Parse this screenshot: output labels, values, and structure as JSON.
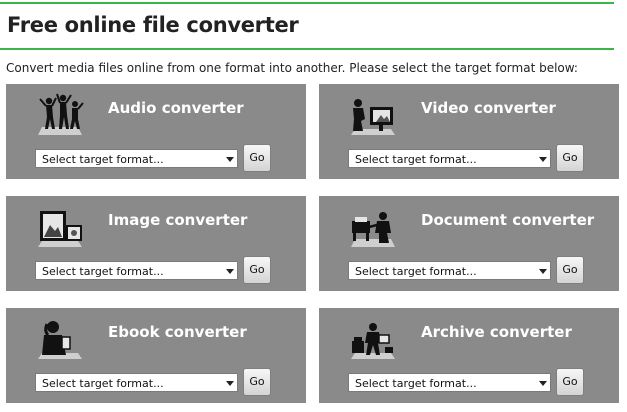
{
  "header": {
    "title": "Free online file converter"
  },
  "intro": "Convert media files online from one format into another. Please select the target format below:",
  "converters": [
    {
      "title": "Audio converter",
      "icon": "dancing-people-icon",
      "select_value": "Select target format...",
      "go_label": "Go"
    },
    {
      "title": "Video converter",
      "icon": "video-viewer-icon",
      "select_value": "Select target format...",
      "go_label": "Go"
    },
    {
      "title": "Image converter",
      "icon": "picture-frame-icon",
      "select_value": "Select target format...",
      "go_label": "Go"
    },
    {
      "title": "Document converter",
      "icon": "document-printer-icon",
      "select_value": "Select target format...",
      "go_label": "Go"
    },
    {
      "title": "Ebook converter",
      "icon": "ebook-reader-icon",
      "select_value": "Select target format...",
      "go_label": "Go"
    },
    {
      "title": "Archive converter",
      "icon": "archive-boxes-icon",
      "select_value": "Select target format...",
      "go_label": "Go"
    }
  ],
  "colors": {
    "accent": "#3cb44a",
    "card": "#8a8a8a"
  }
}
